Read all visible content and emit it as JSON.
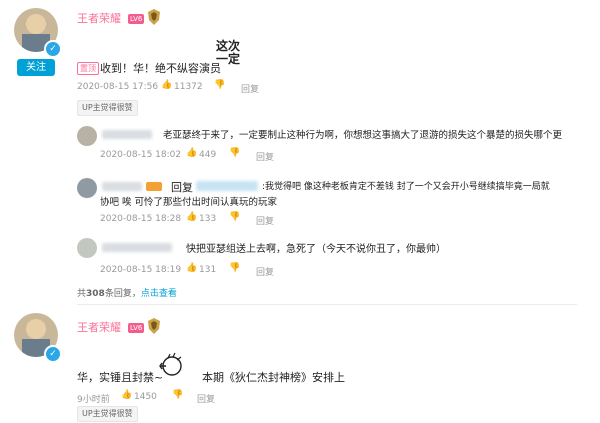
{
  "comment1": {
    "username": "王者荣耀",
    "level": "LV6",
    "follow_label": "关注",
    "pinned_tag": "置顶",
    "text": "收到！华！绝不纵容演员",
    "handwritten": [
      "这次",
      "一定"
    ],
    "date": "2020-08-15 17:56",
    "likes": "11372",
    "reply_label": "回复",
    "up_tag": "UP主觉得很赞",
    "replies": [
      {
        "text": "老亚瑟终于来了，一定要制止这种行为啊，你想想这事搞大了退游的损失这个暴楚的损失哪个更",
        "date": "2020-08-15 18:02",
        "likes": "449",
        "reply_label": "回复"
      },
      {
        "prefix": "回复",
        "text_line1": ":我觉得吧 像这种老板肯定不差钱 封了一个又会开小号继续搞毕竟一局就",
        "text_line2": "协吧 唉 可怜了那些付出时间认真玩的玩家",
        "date": "2020-08-15 18:28",
        "likes": "133",
        "reply_label": "回复"
      },
      {
        "text": "快把亚瑟组送上去啊，急死了（今天不说你丑了，你最帅）",
        "date": "2020-08-15 18:19",
        "likes": "131",
        "reply_label": "回复"
      }
    ],
    "total_prefix": "共",
    "total_count": "308",
    "total_suffix": "条回复，",
    "view_label": "点击查看"
  },
  "comment2": {
    "username": "王者荣耀",
    "level": "LV6",
    "text_left": "华，实锤且封禁~",
    "text_right": "本期《狄仁杰封神榜》安排上",
    "time": "9小时前",
    "likes": "1450",
    "reply_label": "回复",
    "up_tag": "UP主觉得很赞"
  },
  "colors": {
    "accent": "#00a1d6",
    "username": "#fb7299",
    "meta": "#999999"
  },
  "icons": [
    "like-icon",
    "dislike-icon",
    "verified-icon",
    "honor-badge-icon",
    "pointing-hand-icon"
  ]
}
